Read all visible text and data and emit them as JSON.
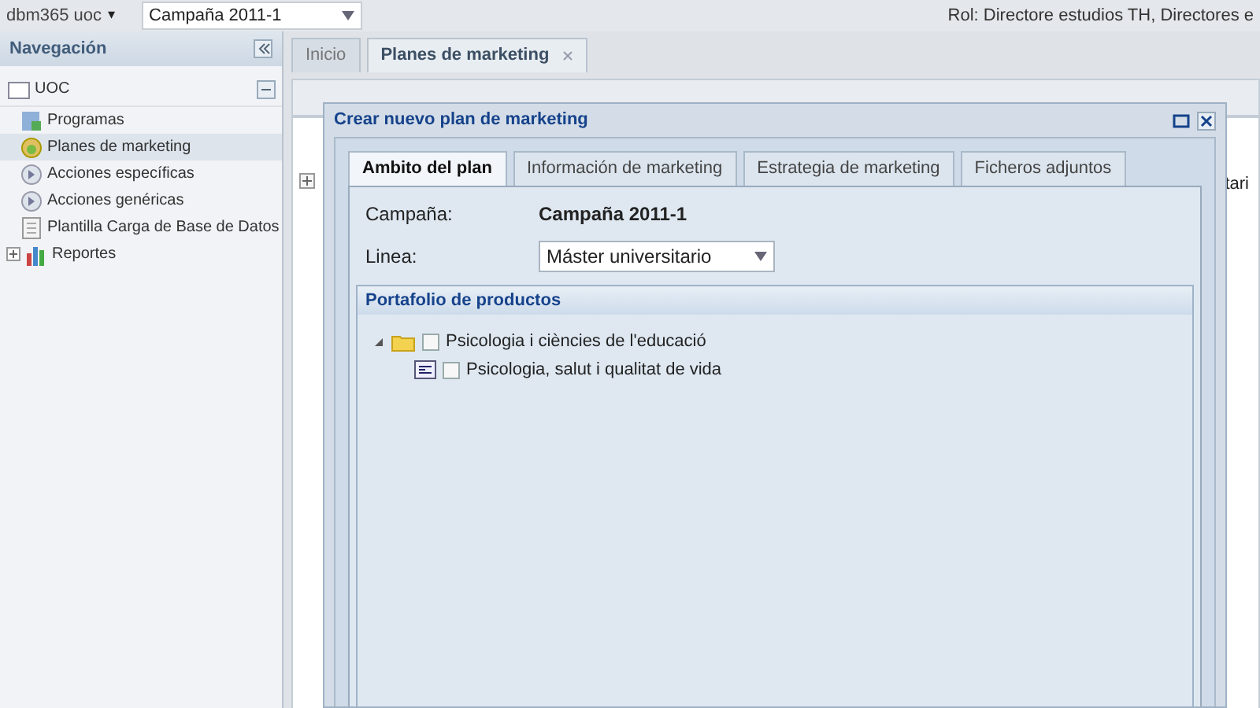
{
  "topbar": {
    "user": "dbm365 uoc",
    "user_caret": "▾",
    "campaign": "Campaña 2011-1",
    "role": "Rol: Directore estudios TH, Directores e"
  },
  "sidebar": {
    "title": "Navegación",
    "items": [
      {
        "label": "UOC",
        "kind": "folder",
        "expanded": true,
        "children": [
          {
            "label": "Programas",
            "kind": "program",
            "selected": false
          },
          {
            "label": "Planes de marketing",
            "kind": "plan",
            "selected": true
          },
          {
            "label": "Acciones específicas",
            "kind": "action",
            "selected": false
          },
          {
            "label": "Acciones genéricas",
            "kind": "action",
            "selected": false
          },
          {
            "label": "Plantilla Carga de Base de Datos",
            "kind": "sheet",
            "selected": false
          }
        ]
      },
      {
        "label": "Reportes",
        "kind": "chart",
        "expanded": false
      }
    ]
  },
  "main_tabs": [
    {
      "label": "Inicio",
      "selected": false,
      "closable": false
    },
    {
      "label": "Planes de marketing",
      "selected": true,
      "closable": true
    }
  ],
  "grid": {
    "column_3": "tari"
  },
  "dialog": {
    "title": "Crear nuevo plan de marketing",
    "tabs": [
      {
        "label": "Ambito del plan",
        "selected": true
      },
      {
        "label": "Información de marketing",
        "selected": false
      },
      {
        "label": "Estrategia de marketing",
        "selected": false
      },
      {
        "label": "Ficheros adjuntos",
        "selected": false
      }
    ],
    "campaign_label": "Campaña:",
    "campaign_value": "Campaña 2011-1",
    "line_label": "Linea:",
    "line_value": "Máster universitario",
    "portfolio": {
      "title": "Portafolio de productos",
      "items": [
        {
          "label": "Psicologia i ciències de l'educació",
          "checked": false,
          "expanded": true,
          "children": [
            {
              "label": "Psicologia, salut i qualitat de vida",
              "checked": false
            }
          ]
        }
      ]
    }
  }
}
